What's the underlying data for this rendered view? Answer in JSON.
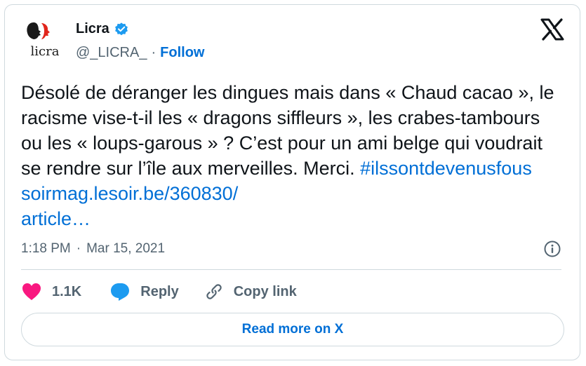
{
  "author": {
    "logo_text": "licra",
    "display_name": "Licra",
    "verified_icon": "verified-badge-icon",
    "handle": "@_LICRA_",
    "separator": "·",
    "follow_label": "Follow"
  },
  "platform_icon": "x-logo-icon",
  "tweet": {
    "text": "Désolé de déranger les dingues mais dans « Chaud cacao », le racisme vise-t-il les « dragons siffleurs », les crabes-tambours ou les « loups-garous » ? C’est pour un ami belge qui voudrait se rendre sur l’île aux merveilles. Merci. ",
    "hashtag": "#ilssontdevenusfous",
    "link_text": "soirmag.lesoir.be/360830/\narticle…"
  },
  "meta": {
    "time": "1:18 PM",
    "separator": "·",
    "date": "Mar 15, 2021",
    "info_icon": "info-icon"
  },
  "actions": {
    "like_count": "1.1K",
    "reply_label": "Reply",
    "copy_link_label": "Copy link"
  },
  "read_more_label": "Read more on X",
  "colors": {
    "link": "#006fd6",
    "like": "#f91880",
    "reply": "#1d9bf0",
    "verified": "#1d9bf0",
    "muted": "#536471",
    "border": "#cfd9de"
  }
}
